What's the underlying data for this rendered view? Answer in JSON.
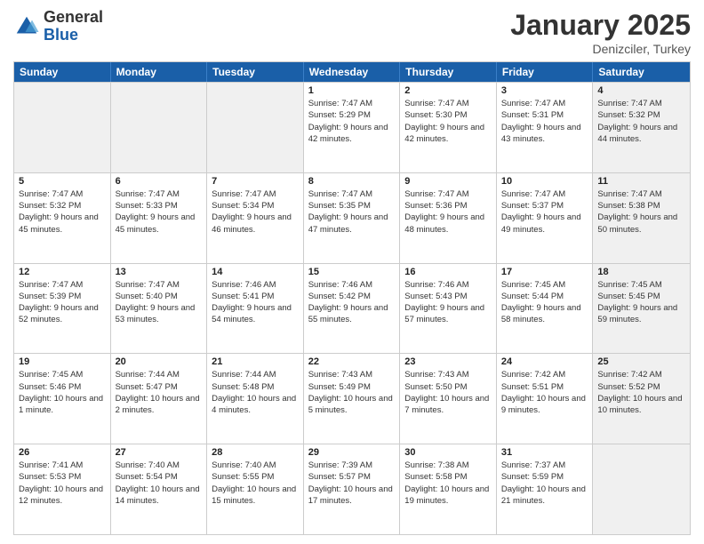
{
  "logo": {
    "general": "General",
    "blue": "Blue"
  },
  "header": {
    "month": "January 2025",
    "location": "Denizciler, Turkey"
  },
  "weekdays": [
    "Sunday",
    "Monday",
    "Tuesday",
    "Wednesday",
    "Thursday",
    "Friday",
    "Saturday"
  ],
  "rows": [
    [
      {
        "day": "",
        "info": "",
        "shaded": true
      },
      {
        "day": "",
        "info": "",
        "shaded": true
      },
      {
        "day": "",
        "info": "",
        "shaded": true
      },
      {
        "day": "1",
        "info": "Sunrise: 7:47 AM\nSunset: 5:29 PM\nDaylight: 9 hours and 42 minutes.",
        "shaded": false
      },
      {
        "day": "2",
        "info": "Sunrise: 7:47 AM\nSunset: 5:30 PM\nDaylight: 9 hours and 42 minutes.",
        "shaded": false
      },
      {
        "day": "3",
        "info": "Sunrise: 7:47 AM\nSunset: 5:31 PM\nDaylight: 9 hours and 43 minutes.",
        "shaded": false
      },
      {
        "day": "4",
        "info": "Sunrise: 7:47 AM\nSunset: 5:32 PM\nDaylight: 9 hours and 44 minutes.",
        "shaded": true
      }
    ],
    [
      {
        "day": "5",
        "info": "Sunrise: 7:47 AM\nSunset: 5:32 PM\nDaylight: 9 hours and 45 minutes.",
        "shaded": false
      },
      {
        "day": "6",
        "info": "Sunrise: 7:47 AM\nSunset: 5:33 PM\nDaylight: 9 hours and 45 minutes.",
        "shaded": false
      },
      {
        "day": "7",
        "info": "Sunrise: 7:47 AM\nSunset: 5:34 PM\nDaylight: 9 hours and 46 minutes.",
        "shaded": false
      },
      {
        "day": "8",
        "info": "Sunrise: 7:47 AM\nSunset: 5:35 PM\nDaylight: 9 hours and 47 minutes.",
        "shaded": false
      },
      {
        "day": "9",
        "info": "Sunrise: 7:47 AM\nSunset: 5:36 PM\nDaylight: 9 hours and 48 minutes.",
        "shaded": false
      },
      {
        "day": "10",
        "info": "Sunrise: 7:47 AM\nSunset: 5:37 PM\nDaylight: 9 hours and 49 minutes.",
        "shaded": false
      },
      {
        "day": "11",
        "info": "Sunrise: 7:47 AM\nSunset: 5:38 PM\nDaylight: 9 hours and 50 minutes.",
        "shaded": true
      }
    ],
    [
      {
        "day": "12",
        "info": "Sunrise: 7:47 AM\nSunset: 5:39 PM\nDaylight: 9 hours and 52 minutes.",
        "shaded": false
      },
      {
        "day": "13",
        "info": "Sunrise: 7:47 AM\nSunset: 5:40 PM\nDaylight: 9 hours and 53 minutes.",
        "shaded": false
      },
      {
        "day": "14",
        "info": "Sunrise: 7:46 AM\nSunset: 5:41 PM\nDaylight: 9 hours and 54 minutes.",
        "shaded": false
      },
      {
        "day": "15",
        "info": "Sunrise: 7:46 AM\nSunset: 5:42 PM\nDaylight: 9 hours and 55 minutes.",
        "shaded": false
      },
      {
        "day": "16",
        "info": "Sunrise: 7:46 AM\nSunset: 5:43 PM\nDaylight: 9 hours and 57 minutes.",
        "shaded": false
      },
      {
        "day": "17",
        "info": "Sunrise: 7:45 AM\nSunset: 5:44 PM\nDaylight: 9 hours and 58 minutes.",
        "shaded": false
      },
      {
        "day": "18",
        "info": "Sunrise: 7:45 AM\nSunset: 5:45 PM\nDaylight: 9 hours and 59 minutes.",
        "shaded": true
      }
    ],
    [
      {
        "day": "19",
        "info": "Sunrise: 7:45 AM\nSunset: 5:46 PM\nDaylight: 10 hours and 1 minute.",
        "shaded": false
      },
      {
        "day": "20",
        "info": "Sunrise: 7:44 AM\nSunset: 5:47 PM\nDaylight: 10 hours and 2 minutes.",
        "shaded": false
      },
      {
        "day": "21",
        "info": "Sunrise: 7:44 AM\nSunset: 5:48 PM\nDaylight: 10 hours and 4 minutes.",
        "shaded": false
      },
      {
        "day": "22",
        "info": "Sunrise: 7:43 AM\nSunset: 5:49 PM\nDaylight: 10 hours and 5 minutes.",
        "shaded": false
      },
      {
        "day": "23",
        "info": "Sunrise: 7:43 AM\nSunset: 5:50 PM\nDaylight: 10 hours and 7 minutes.",
        "shaded": false
      },
      {
        "day": "24",
        "info": "Sunrise: 7:42 AM\nSunset: 5:51 PM\nDaylight: 10 hours and 9 minutes.",
        "shaded": false
      },
      {
        "day": "25",
        "info": "Sunrise: 7:42 AM\nSunset: 5:52 PM\nDaylight: 10 hours and 10 minutes.",
        "shaded": true
      }
    ],
    [
      {
        "day": "26",
        "info": "Sunrise: 7:41 AM\nSunset: 5:53 PM\nDaylight: 10 hours and 12 minutes.",
        "shaded": false
      },
      {
        "day": "27",
        "info": "Sunrise: 7:40 AM\nSunset: 5:54 PM\nDaylight: 10 hours and 14 minutes.",
        "shaded": false
      },
      {
        "day": "28",
        "info": "Sunrise: 7:40 AM\nSunset: 5:55 PM\nDaylight: 10 hours and 15 minutes.",
        "shaded": false
      },
      {
        "day": "29",
        "info": "Sunrise: 7:39 AM\nSunset: 5:57 PM\nDaylight: 10 hours and 17 minutes.",
        "shaded": false
      },
      {
        "day": "30",
        "info": "Sunrise: 7:38 AM\nSunset: 5:58 PM\nDaylight: 10 hours and 19 minutes.",
        "shaded": false
      },
      {
        "day": "31",
        "info": "Sunrise: 7:37 AM\nSunset: 5:59 PM\nDaylight: 10 hours and 21 minutes.",
        "shaded": false
      },
      {
        "day": "",
        "info": "",
        "shaded": true
      }
    ]
  ]
}
